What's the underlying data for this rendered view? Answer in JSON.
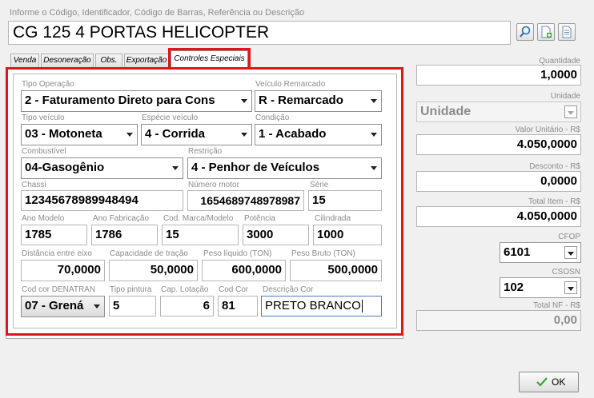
{
  "search": {
    "label": "Informe o Código, Identificador, Código de Barras, Referência ou Descrição",
    "value": "CG 125 4 PORTAS HELICOPTER"
  },
  "toolbar_icons": [
    "search-icon",
    "add-document-icon",
    "document-icon"
  ],
  "tabs": [
    {
      "label": "Venda",
      "active": false
    },
    {
      "label": "Desoneração",
      "active": false
    },
    {
      "label": "Obs.",
      "active": false
    },
    {
      "label": "Exportação",
      "active": false
    },
    {
      "label": "Controles Especiais",
      "active": true
    }
  ],
  "form": {
    "tipo_operacao": {
      "label": "Tipo Operação",
      "value": "2 - Faturamento Direto para Cons"
    },
    "veiculo_remarcado": {
      "label": "Veículo Remarcado",
      "value": "R - Remarcado"
    },
    "tipo_veiculo": {
      "label": "Tipo veículo",
      "value": "03 - Motoneta"
    },
    "especie_veiculo": {
      "label": "Espécie veículo",
      "value": "4 - Corrida"
    },
    "condicao": {
      "label": "Condição",
      "value": "1 - Acabado"
    },
    "combustivel": {
      "label": "Combustível",
      "value": "04-Gasogênio"
    },
    "restricao": {
      "label": "Restrição",
      "value": "4 - Penhor de Veículos"
    },
    "chassi": {
      "label": "Chassi",
      "value": "12345678989948494"
    },
    "numero_motor": {
      "label": "Número motor",
      "value": "1654689748978987"
    },
    "serie": {
      "label": "Série",
      "value": "15"
    },
    "ano_modelo": {
      "label": "Ano Modelo",
      "value": "1785"
    },
    "ano_fabricacao": {
      "label": "Ano Fabricação",
      "value": "1786"
    },
    "cod_marca_modelo": {
      "label": "Cod. Marca/Modelo",
      "value": "15"
    },
    "potencia": {
      "label": "Potência",
      "value": "3000"
    },
    "cilindrada": {
      "label": "Cilindrada",
      "value": "1000"
    },
    "distancia_eixo": {
      "label": "Distância entre eixo",
      "value": "70,0000"
    },
    "capacidade_tracao": {
      "label": "Capacidade de tração",
      "value": "50,0000"
    },
    "peso_liquido": {
      "label": "Peso líquido (TON)",
      "value": "600,0000"
    },
    "peso_bruto": {
      "label": "Peso Bruto (TON)",
      "value": "500,0000"
    },
    "cod_cor_denatran": {
      "label": "Cod cor DENATRAN",
      "value": "07 - Grená"
    },
    "tipo_pintura": {
      "label": "Tipo pintura",
      "value": "5"
    },
    "cap_lotacao": {
      "label": "Cap. Lotação",
      "value": "6"
    },
    "cod_cor": {
      "label": "Cod Cor",
      "value": "81"
    },
    "descricao_cor": {
      "label": "Descrição Cor",
      "value": "PRETO BRANCO"
    }
  },
  "side": {
    "quantidade": {
      "label": "Quantidade",
      "value": "1,0000"
    },
    "unidade": {
      "label": "Unidade",
      "value": "Unidade"
    },
    "valor_unitario": {
      "label": "Valor Unitário - R$",
      "value": "4.050,0000"
    },
    "desconto": {
      "label": "Desconto - R$",
      "value": "0,0000"
    },
    "total_item": {
      "label": "Total Item - R$",
      "value": "4.050,0000"
    },
    "cfop": {
      "label": "CFOP",
      "value": "6101"
    },
    "csosn": {
      "label": "CSOSN",
      "value": "102"
    },
    "total_nf": {
      "label": "Total NF - R$",
      "value": "0,00"
    }
  },
  "ok_button": {
    "label": "OK"
  },
  "colors": {
    "highlight": "#e0141c",
    "check": "#3aa530"
  }
}
